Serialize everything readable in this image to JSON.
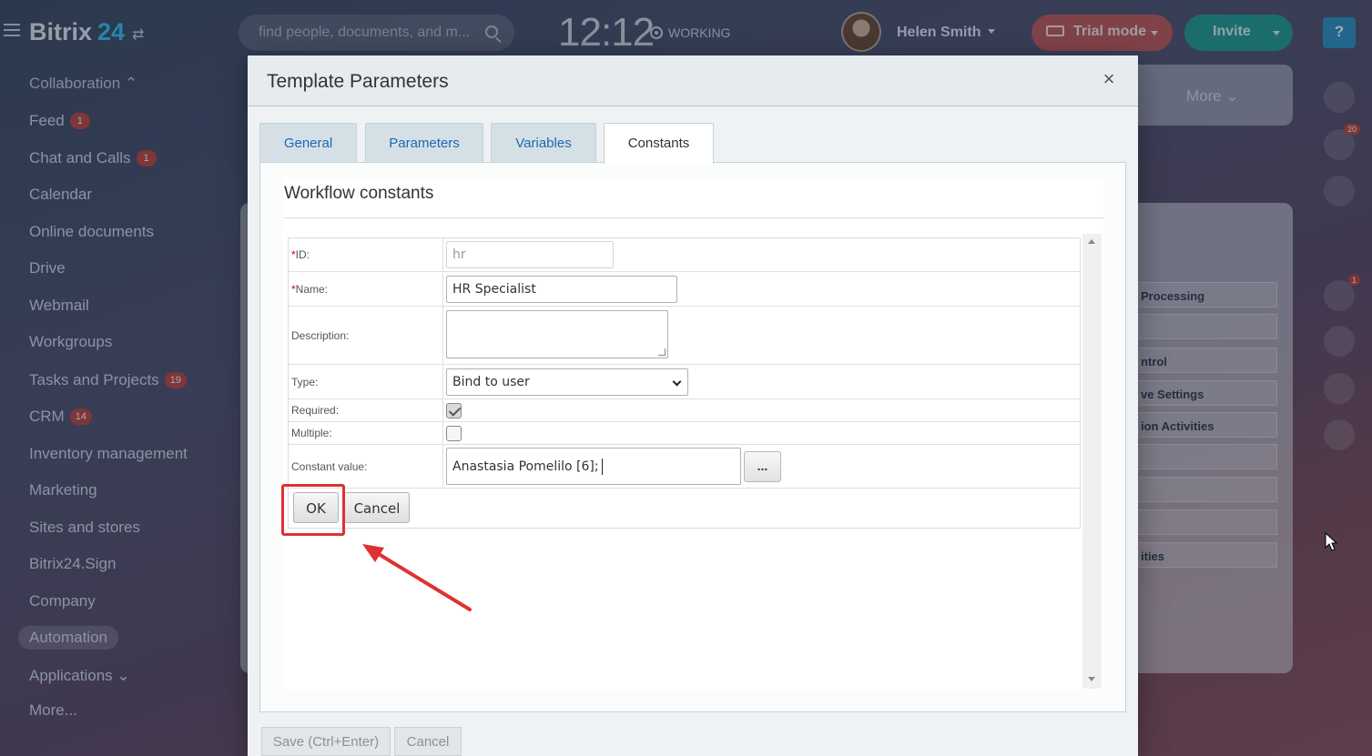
{
  "header": {
    "logo_word": "Bitrix",
    "logo_number": "24",
    "search_placeholder": "find people, documents, and m...",
    "clock": "12:12",
    "working_status": "WORKING",
    "user_name": "Helen Smith",
    "trial_label": "Trial mode",
    "invite_label": "Invite",
    "help_label": "?"
  },
  "sidebar": {
    "group_title": "Collaboration",
    "items": [
      {
        "label": "Feed",
        "badge": "1"
      },
      {
        "label": "Chat and Calls",
        "badge": "1"
      },
      {
        "label": "Calendar",
        "badge": ""
      },
      {
        "label": "Online documents",
        "badge": ""
      },
      {
        "label": "Drive",
        "badge": ""
      },
      {
        "label": "Webmail",
        "badge": ""
      },
      {
        "label": "Workgroups",
        "badge": ""
      },
      {
        "label": "Tasks and Projects",
        "badge": "19"
      },
      {
        "label": "CRM",
        "badge": "14"
      },
      {
        "label": "Inventory management",
        "badge": ""
      },
      {
        "label": "Marketing",
        "badge": ""
      },
      {
        "label": "Sites and stores",
        "badge": ""
      },
      {
        "label": "Bitrix24.Sign",
        "badge": ""
      },
      {
        "label": "Company",
        "badge": ""
      },
      {
        "label": "Automation",
        "badge": ""
      },
      {
        "label": "Applications",
        "badge": ""
      },
      {
        "label": "More...",
        "badge": ""
      }
    ]
  },
  "background": {
    "more_label": "More",
    "rows": [
      "Processing",
      "ntrol",
      "ve Settings",
      "ion Activities",
      "ities"
    ],
    "notification_count": "20",
    "avatar_badge": "1"
  },
  "modal": {
    "title": "Template Parameters",
    "close_label": "×",
    "tabs": [
      {
        "label": "General"
      },
      {
        "label": "Parameters"
      },
      {
        "label": "Variables"
      },
      {
        "label": "Constants"
      }
    ],
    "section_title": "Workflow constants",
    "form": {
      "id_label": "ID:",
      "id_value": "hr",
      "name_label": "Name:",
      "name_value": "HR Specialist",
      "description_label": "Description:",
      "description_value": "",
      "type_label": "Type:",
      "type_value": "Bind to user",
      "required_label": "Required:",
      "required_checked": true,
      "multiple_label": "Multiple:",
      "multiple_checked": false,
      "constant_value_label": "Constant value:",
      "constant_value": "Anastasia Pomelilo [6];",
      "ellipsis_label": "...",
      "ok_label": "OK",
      "cancel_label": "Cancel"
    },
    "footer": {
      "save_label": "Save (Ctrl+Enter)",
      "cancel_label": "Cancel"
    }
  },
  "annotation_color": "#e03131"
}
